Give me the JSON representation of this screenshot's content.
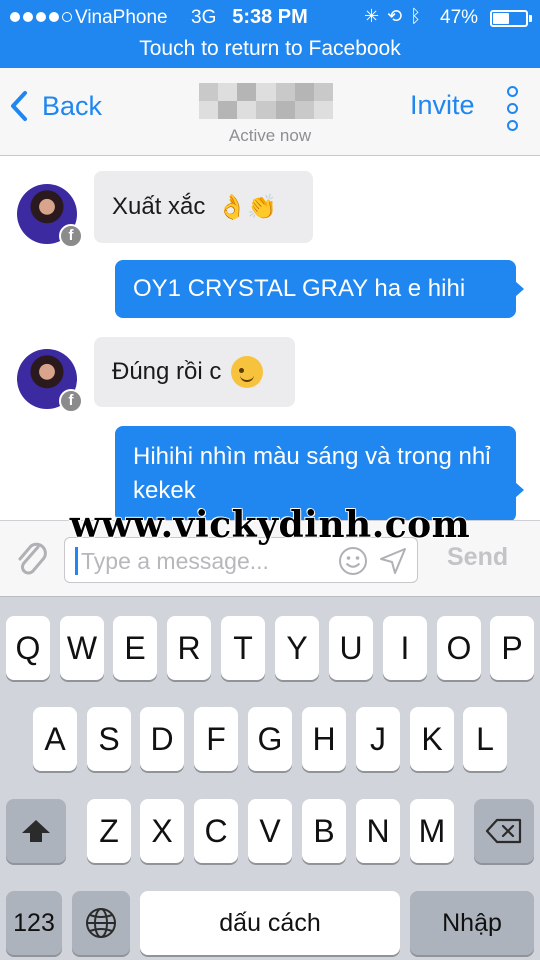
{
  "status_bar": {
    "carrier": "VinaPhone",
    "network": "3G",
    "time": "5:38 PM",
    "battery_percent": "47%",
    "battery_level": 0.47,
    "signal_bars_filled": 4,
    "icons": [
      "activity-spinner-icon",
      "rotation-lock-icon",
      "bluetooth-icon"
    ]
  },
  "banner": {
    "text": "Touch to return to Facebook"
  },
  "nav": {
    "back_label": "Back",
    "contact_status": "Active now",
    "invite_label": "Invite",
    "more_icon": "vertical-dots-icon"
  },
  "messages": [
    {
      "direction": "incoming",
      "text": "Xuất xắc",
      "emoji": "👌👏"
    },
    {
      "direction": "outgoing",
      "text": "OY1 CRYSTAL GRAY ha e hihi"
    },
    {
      "direction": "incoming",
      "text": "Đúng rồi c",
      "emoji": "wink-emoji"
    },
    {
      "direction": "outgoing",
      "text": "Hihihi nhìn màu sáng và trong nhỉ kekek"
    }
  ],
  "avatar_badge": "f",
  "watermark": "www.vickydinh.com",
  "composer": {
    "placeholder": "Type a message...",
    "send_label": "Send"
  },
  "keyboard": {
    "row1": [
      "Q",
      "W",
      "E",
      "R",
      "T",
      "Y",
      "U",
      "I",
      "O",
      "P"
    ],
    "row2": [
      "A",
      "S",
      "D",
      "F",
      "G",
      "H",
      "J",
      "K",
      "L"
    ],
    "row3": [
      "Z",
      "X",
      "C",
      "V",
      "B",
      "N",
      "M"
    ],
    "numbers_label": "123",
    "space_label": "dấu cách",
    "return_label": "Nhập"
  },
  "colors": {
    "accent": "#1f87ef",
    "incoming_bubble": "#ececef",
    "keyboard_bg": "#d1d5db"
  }
}
